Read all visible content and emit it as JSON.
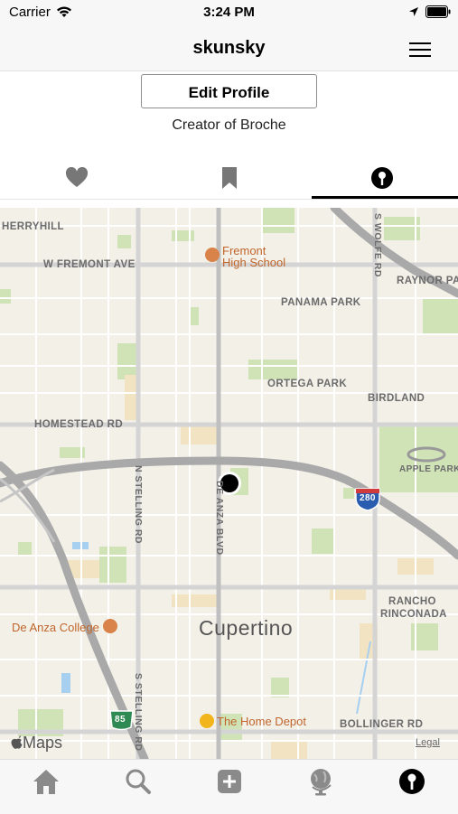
{
  "status_bar": {
    "carrier": "Carrier",
    "time": "3:24 PM"
  },
  "nav": {
    "title": "skunsky"
  },
  "profile": {
    "edit_button": "Edit Profile",
    "bio": "Creator of Broche"
  },
  "tabs": [
    {
      "icon": "heart-icon",
      "selected": false
    },
    {
      "icon": "bookmark-icon",
      "selected": false
    },
    {
      "icon": "location-pin-icon",
      "selected": true
    }
  ],
  "map": {
    "streets": {
      "herryhill": "HERRYHILL",
      "w_fremont": "W FREMONT AVE",
      "wolfe": "S WOLFE RD",
      "raynor": "RAYNOR PA",
      "panama": "PANAMA PARK",
      "ortega": "ORTEGA PARK",
      "birdland": "BIRDLAND",
      "homestead": "HOMESTEAD RD",
      "apple_park": "APPLE PARK",
      "n_stelling": "N STELLING RD",
      "de_anza": "DE ANZA BLVD",
      "rancho1": "RANCHO",
      "rancho2": "RINCONADA",
      "s_stelling": "S STELLING RD",
      "bollinger": "BOLLINGER RD"
    },
    "pois": {
      "fremont_hs1": "Fremont",
      "fremont_hs2": "High School",
      "de_anza_college": "De Anza College",
      "home_depot": "The Home Depot"
    },
    "city": "Cupertino",
    "shields": {
      "i280": "280",
      "hwy85": "85"
    },
    "attribution": "Maps",
    "legal": "Legal"
  },
  "tab_bar": [
    {
      "icon": "home-icon"
    },
    {
      "icon": "search-icon"
    },
    {
      "icon": "add-icon"
    },
    {
      "icon": "globe-icon"
    },
    {
      "icon": "profile-pin-icon",
      "selected": true
    }
  ]
}
